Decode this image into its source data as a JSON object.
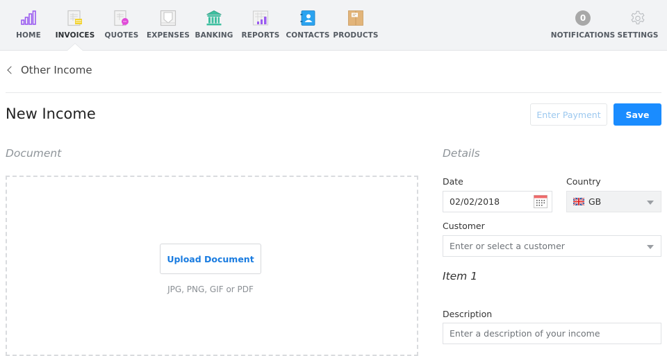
{
  "nav": {
    "items": [
      {
        "id": "home",
        "label": "HOME",
        "icon": "bar-chart-icon"
      },
      {
        "id": "invoices",
        "label": "INVOICES",
        "icon": "invoice-icon",
        "active": true
      },
      {
        "id": "quotes",
        "label": "QUOTES",
        "icon": "quote-icon"
      },
      {
        "id": "expenses",
        "label": "EXPENSES",
        "icon": "expense-tray-icon"
      },
      {
        "id": "banking",
        "label": "BANKING",
        "icon": "bank-icon"
      },
      {
        "id": "reports",
        "label": "REPORTS",
        "icon": "report-icon"
      },
      {
        "id": "contacts",
        "label": "CONTACTS",
        "icon": "address-book-icon"
      },
      {
        "id": "products",
        "label": "PRODUCTS",
        "icon": "box-icon"
      }
    ],
    "notifications": {
      "label": "NOTIFICATIONS",
      "count": "0"
    },
    "settings": {
      "label": "SETTINGS",
      "icon": "gear-icon"
    }
  },
  "breadcrumb": {
    "back_label": "Other Income"
  },
  "header": {
    "title": "New Income",
    "enter_payment_label": "Enter Payment",
    "save_label": "Save"
  },
  "document": {
    "section_title": "Document",
    "upload_label": "Upload Document",
    "hint": "JPG, PNG, GIF or PDF"
  },
  "details": {
    "section_title": "Details",
    "date": {
      "label": "Date",
      "value": "02/02/2018"
    },
    "country": {
      "label": "Country",
      "value": "GB",
      "flag": "uk-flag-icon"
    },
    "customer": {
      "label": "Customer",
      "placeholder": "Enter or select a customer"
    },
    "item_title": "Item 1",
    "description": {
      "label": "Description",
      "placeholder": "Enter a description of your income"
    }
  },
  "colors": {
    "primary": "#1a8cff",
    "nav_bg": "#f2f3f5",
    "link": "#1a7ce0"
  }
}
